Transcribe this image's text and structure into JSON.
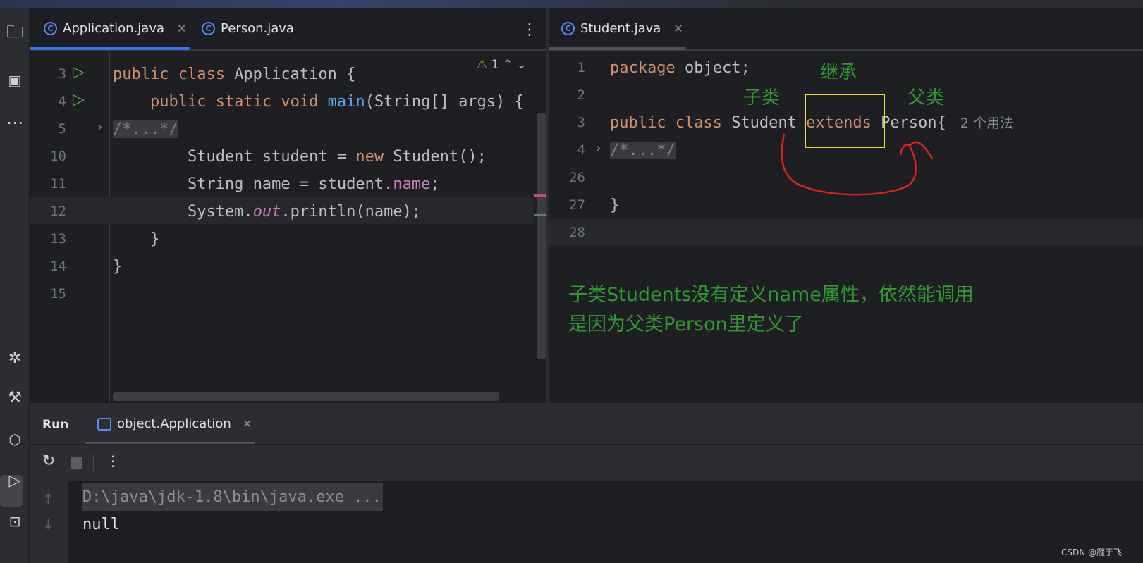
{
  "left_toolbar": {
    "icons": [
      "folder-icon",
      "structure-icon",
      "more-icon",
      "debug-icon",
      "build-icon",
      "services-icon",
      "run-icon",
      "terminal-icon"
    ]
  },
  "left_editor": {
    "tabs": [
      {
        "label": "Application.java",
        "active": true
      },
      {
        "label": "Person.java",
        "active": false
      }
    ],
    "warning_count": "1",
    "lines": [
      {
        "n": "3",
        "run": true,
        "tokens": [
          [
            "kw",
            "public class "
          ],
          [
            "pl",
            "Application {"
          ]
        ]
      },
      {
        "n": "4",
        "run": true,
        "tokens": [
          [
            "kw",
            "    public static void "
          ],
          [
            "fn",
            "main"
          ],
          [
            "pl",
            "(String[] args) {"
          ]
        ]
      },
      {
        "n": "5",
        "fold": true,
        "tokens": [
          [
            "cm",
            "/*...*/"
          ]
        ]
      },
      {
        "n": "10",
        "tokens": [
          [
            "pl",
            "        Student student = "
          ],
          [
            "kw",
            "new "
          ],
          [
            "pl",
            "Student();"
          ]
        ]
      },
      {
        "n": "11",
        "tokens": [
          [
            "pl",
            "        String "
          ],
          [
            "pl",
            "name"
          ],
          [
            "pl",
            " = student."
          ],
          [
            "fld",
            "name"
          ],
          [
            "pl",
            ";"
          ]
        ]
      },
      {
        "n": "12",
        "tokens": [
          [
            "pl",
            "        System."
          ],
          [
            "it",
            "out"
          ],
          [
            "pl",
            ".println(name);"
          ]
        ]
      },
      {
        "n": "13",
        "tokens": [
          [
            "pl",
            "    }"
          ]
        ]
      },
      {
        "n": "14",
        "tokens": [
          [
            "pl",
            "}"
          ]
        ]
      },
      {
        "n": "15",
        "tokens": []
      }
    ]
  },
  "right_editor": {
    "tabs": [
      {
        "label": "Student.java",
        "active": true
      }
    ],
    "lines": [
      {
        "n": "1",
        "tokens": [
          [
            "kw",
            "package "
          ],
          [
            "pl",
            "object;"
          ]
        ]
      },
      {
        "n": "2",
        "tokens": []
      },
      {
        "n": "3",
        "tokens": [
          [
            "kw",
            "public class "
          ],
          [
            "pl",
            "Student "
          ],
          [
            "kw",
            "extends "
          ],
          [
            "pl",
            "Person{"
          ]
        ],
        "hint": "2 个用法"
      },
      {
        "n": "4",
        "fold": true,
        "tokens": [
          [
            "cm",
            "/*...*/"
          ]
        ]
      },
      {
        "n": "26",
        "tokens": []
      },
      {
        "n": "27",
        "tokens": [
          [
            "pl",
            "}"
          ]
        ]
      },
      {
        "n": "28",
        "tokens": []
      }
    ]
  },
  "annotations": {
    "inherit": "继承",
    "subclass": "子类",
    "superclass": "父类",
    "note_line1": "子类Students没有定义name属性，依然能调用",
    "note_line2": "是因为父类Person里定义了",
    "box_color": "#f0e000",
    "curve_color": "#e02020"
  },
  "run_panel": {
    "title": "Run",
    "tab": "object.Application",
    "console": [
      "D:\\java\\jdk-1.8\\bin\\java.exe ...",
      "null"
    ]
  },
  "watermark": "CSDN @雁于飞"
}
